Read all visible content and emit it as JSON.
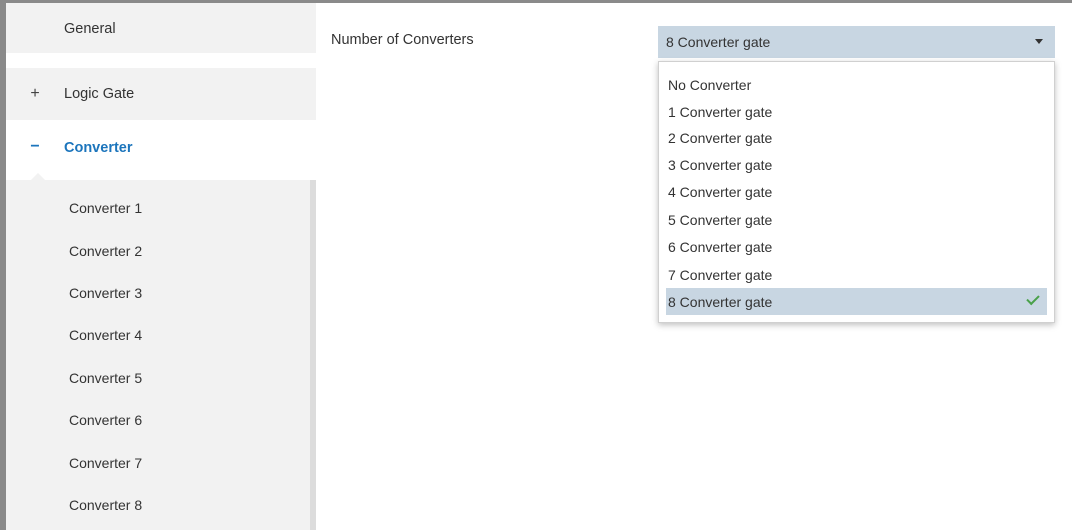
{
  "sidebar": {
    "general": "General",
    "logic_gate": "Logic Gate",
    "converter": "Converter",
    "expand_sign": "+",
    "collapse_sign": "−",
    "sub_items": [
      "Converter 1",
      "Converter 2",
      "Converter 3",
      "Converter 4",
      "Converter 5",
      "Converter 6",
      "Converter 7",
      "Converter 8"
    ]
  },
  "main": {
    "field_label": "Number of Converters",
    "select_value": "8 Converter gate",
    "options": [
      "No Converter",
      "1 Converter gate",
      "2 Converter gate",
      "3 Converter gate",
      "4 Converter gate",
      "5 Converter gate",
      "6 Converter gate",
      "7 Converter gate",
      "8 Converter gate"
    ],
    "selected_index": 8
  },
  "colors": {
    "accent": "#1c75bc",
    "selection": "#c8d6e2",
    "check": "#4aa14a"
  },
  "icons": [
    "caret-down-icon",
    "checkmark-icon"
  ]
}
